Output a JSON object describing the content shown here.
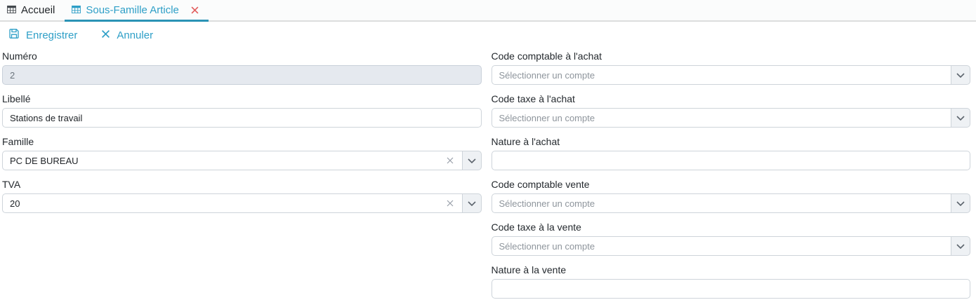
{
  "tabs": [
    {
      "label": "Accueil",
      "icon": "table-icon",
      "active": false,
      "closable": false
    },
    {
      "label": "Sous-Famille Article",
      "icon": "table-icon",
      "active": true,
      "closable": true
    }
  ],
  "toolbar": {
    "save_label": "Enregistrer",
    "cancel_label": "Annuler"
  },
  "form": {
    "left": [
      {
        "label": "Numéro",
        "value": "2",
        "type": "text-disabled"
      },
      {
        "label": "Libellé",
        "value": "Stations de travail",
        "type": "text"
      },
      {
        "label": "Famille",
        "value": "PC DE BUREAU",
        "type": "combo-clearable"
      },
      {
        "label": "TVA",
        "value": "20",
        "type": "combo-clearable"
      }
    ],
    "right": [
      {
        "label": "Code comptable à l'achat",
        "placeholder": "Sélectionner un compte",
        "type": "combo"
      },
      {
        "label": "Code taxe à l'achat",
        "placeholder": "Sélectionner un compte",
        "type": "combo"
      },
      {
        "label": "Nature à l'achat",
        "value": "",
        "type": "text"
      },
      {
        "label": "Code comptable vente",
        "placeholder": "Sélectionner un compte",
        "type": "combo"
      },
      {
        "label": "Code taxe à la vente",
        "placeholder": "Sélectionner un compte",
        "type": "combo"
      },
      {
        "label": "Nature à la vente",
        "value": "",
        "type": "text"
      }
    ]
  },
  "icons": {
    "tab": "table-icon",
    "save": "floppy-disk-icon",
    "cancel": "x-icon",
    "tab_close": "close-icon",
    "clear": "clear-icon",
    "dropdown": "chevron-down-icon"
  },
  "colors": {
    "accent_teal": "#2e9fc7",
    "active_tab_underline": "#2b93b5",
    "close_red": "#e25d5d",
    "input_border": "#ced4da",
    "disabled_input_bg": "#e5e9ef",
    "dropdown_btn_bg": "#eef1f4",
    "label_text": "#24292e",
    "placeholder_text": "#8e959c"
  }
}
